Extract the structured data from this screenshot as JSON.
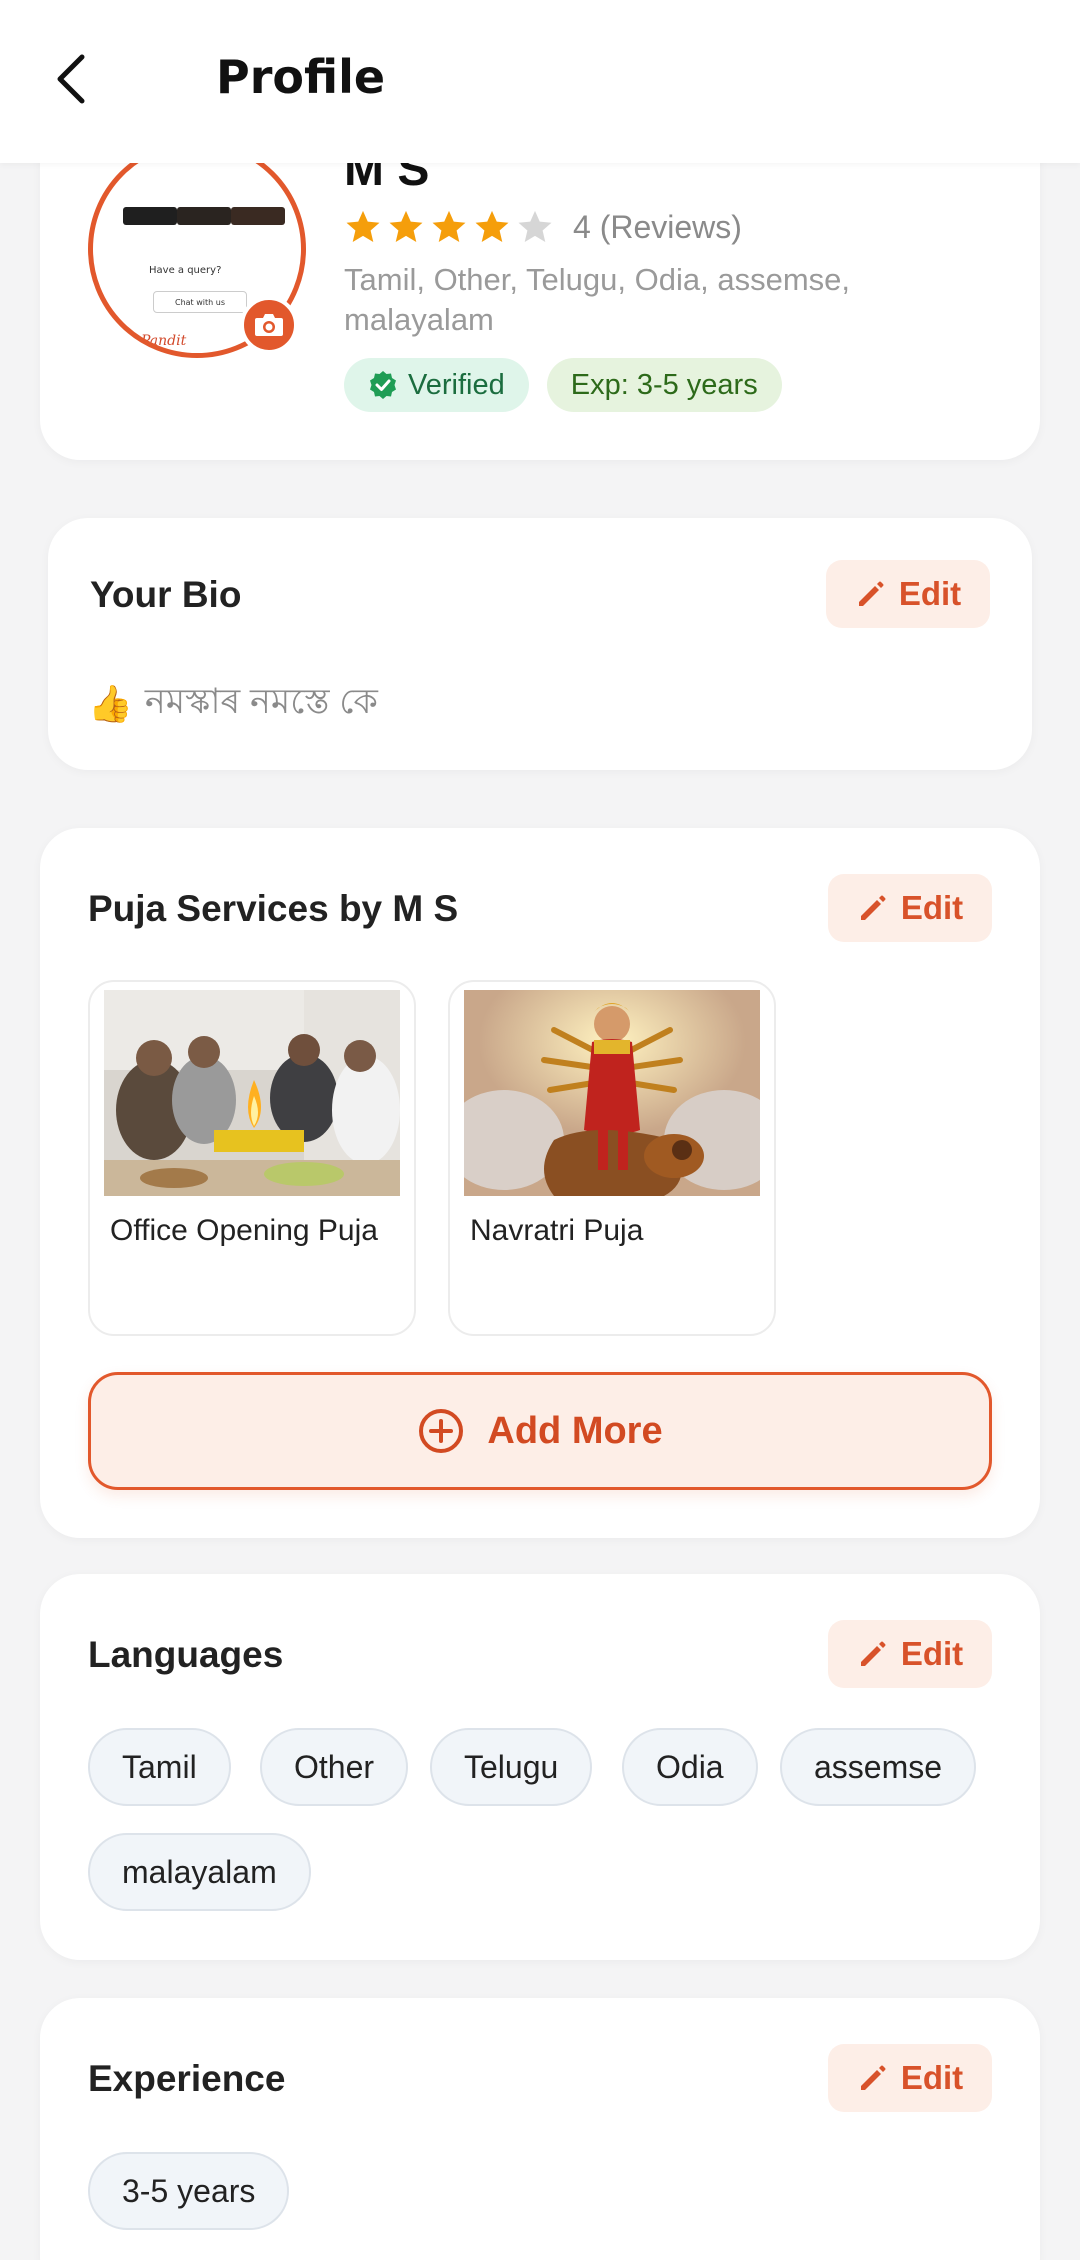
{
  "header": {
    "title": "Profile"
  },
  "profile": {
    "name": "M S",
    "rating": 4,
    "max_rating": 5,
    "reviews_label": "4 (Reviews)",
    "languages_line": "Tamil, Other, Telugu, Odia, assemse, malayalam",
    "verified_label": "Verified",
    "experience_label": "Exp: 3-5 years",
    "avatar_preview": {
      "query_text": "Have a query?",
      "chat_label": "Chat with us",
      "brand_text": "Pandit"
    }
  },
  "bio": {
    "title": "Your Bio",
    "edit_label": "Edit",
    "emoji": "👍",
    "text": "নমস্কাৰ নমস্তে কে"
  },
  "puja": {
    "title": "Puja Services by M S",
    "edit_label": "Edit",
    "items": [
      {
        "name": "Office Opening Puja"
      },
      {
        "name": "Navratri Puja"
      }
    ],
    "add_more_label": "Add More"
  },
  "languages": {
    "title": "Languages",
    "edit_label": "Edit",
    "items": [
      "Tamil",
      "Other",
      "Telugu",
      "Odia",
      "assemse",
      "malayalam"
    ]
  },
  "experience": {
    "title": "Experience",
    "edit_label": "Edit",
    "value": "3-5 years"
  },
  "colors": {
    "accent": "#e2582c",
    "accent_light": "#fdeee7",
    "star": "#f59e0b",
    "verified_bg": "#dff5ea"
  }
}
